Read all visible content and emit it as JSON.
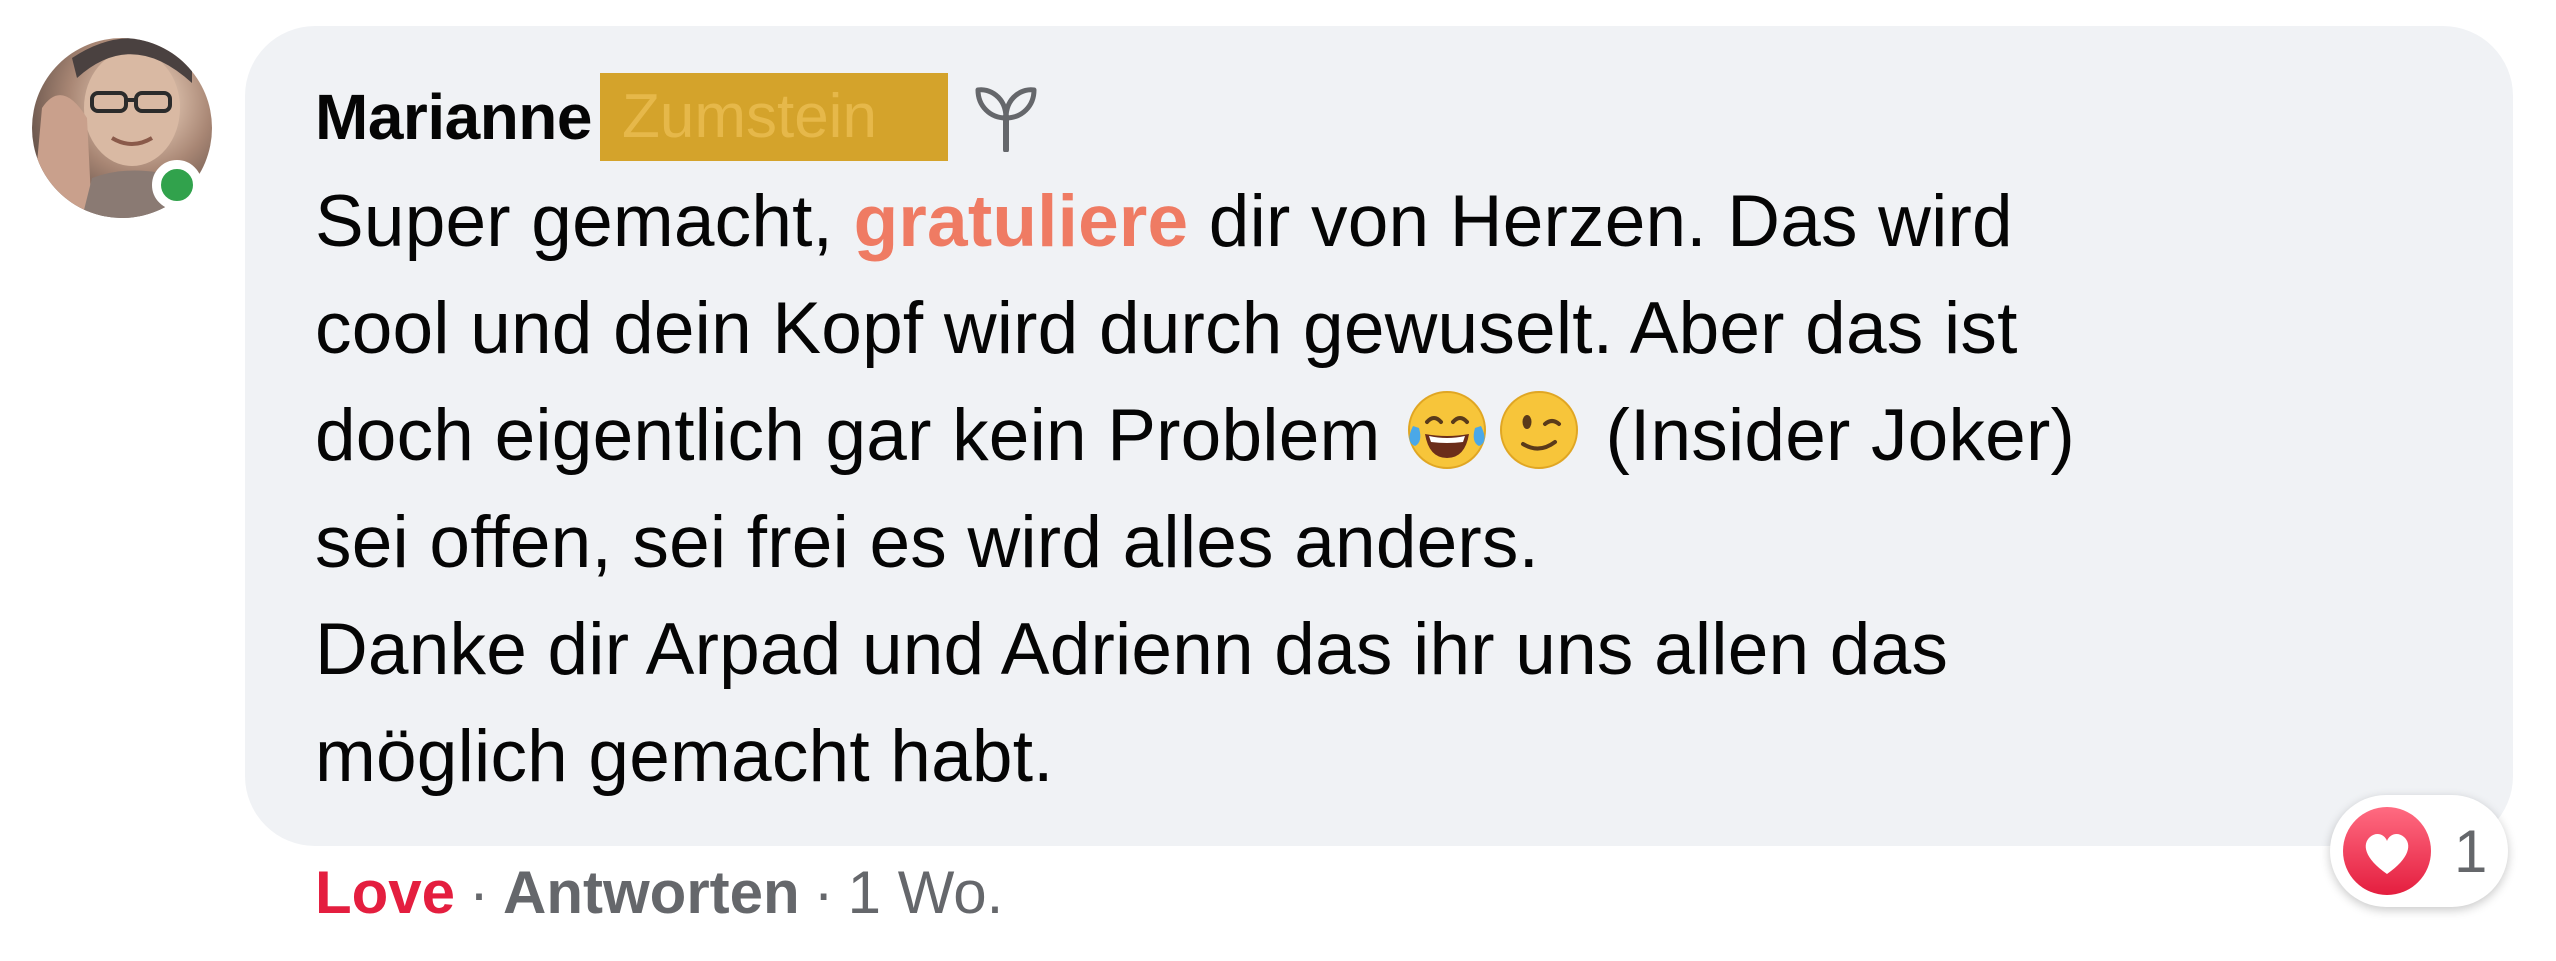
{
  "comment": {
    "author_first_name": "Marianne",
    "author_last_name_redacted": "Zumstein",
    "text": {
      "line1_before": "Super gemacht, ",
      "line1_highlight": "gratuliere",
      "line1_after": " dir von Herzen. Das wird",
      "line2": "cool und dein Kopf wird durch gewuselt. Aber das ist",
      "line3_before": "doch eigentlich gar kein Problem ",
      "line3_after": " (Insider Joker)",
      "line4": "sei offen, sei frei es wird alles anders.",
      "line5": "Danke dir Arpad und Adrienn das ihr uns allen das",
      "line6": "möglich gemacht habt."
    },
    "emojis": [
      "tears-of-joy-emoji",
      "winking-face-emoji"
    ],
    "badge_icon": "sprout-icon"
  },
  "actions": {
    "love_label": "Love",
    "separator": "·",
    "reply_label": "Antworten",
    "time_label": "1 Wo."
  },
  "reaction": {
    "icon": "heart-icon",
    "count": "1"
  },
  "colors": {
    "bubble_bg": "#f0f2f5",
    "highlight": "#ef7b63",
    "love": "#e41e3f",
    "online": "#31a24c",
    "redaction": "#d4a32b",
    "meta_text": "#65676b"
  }
}
